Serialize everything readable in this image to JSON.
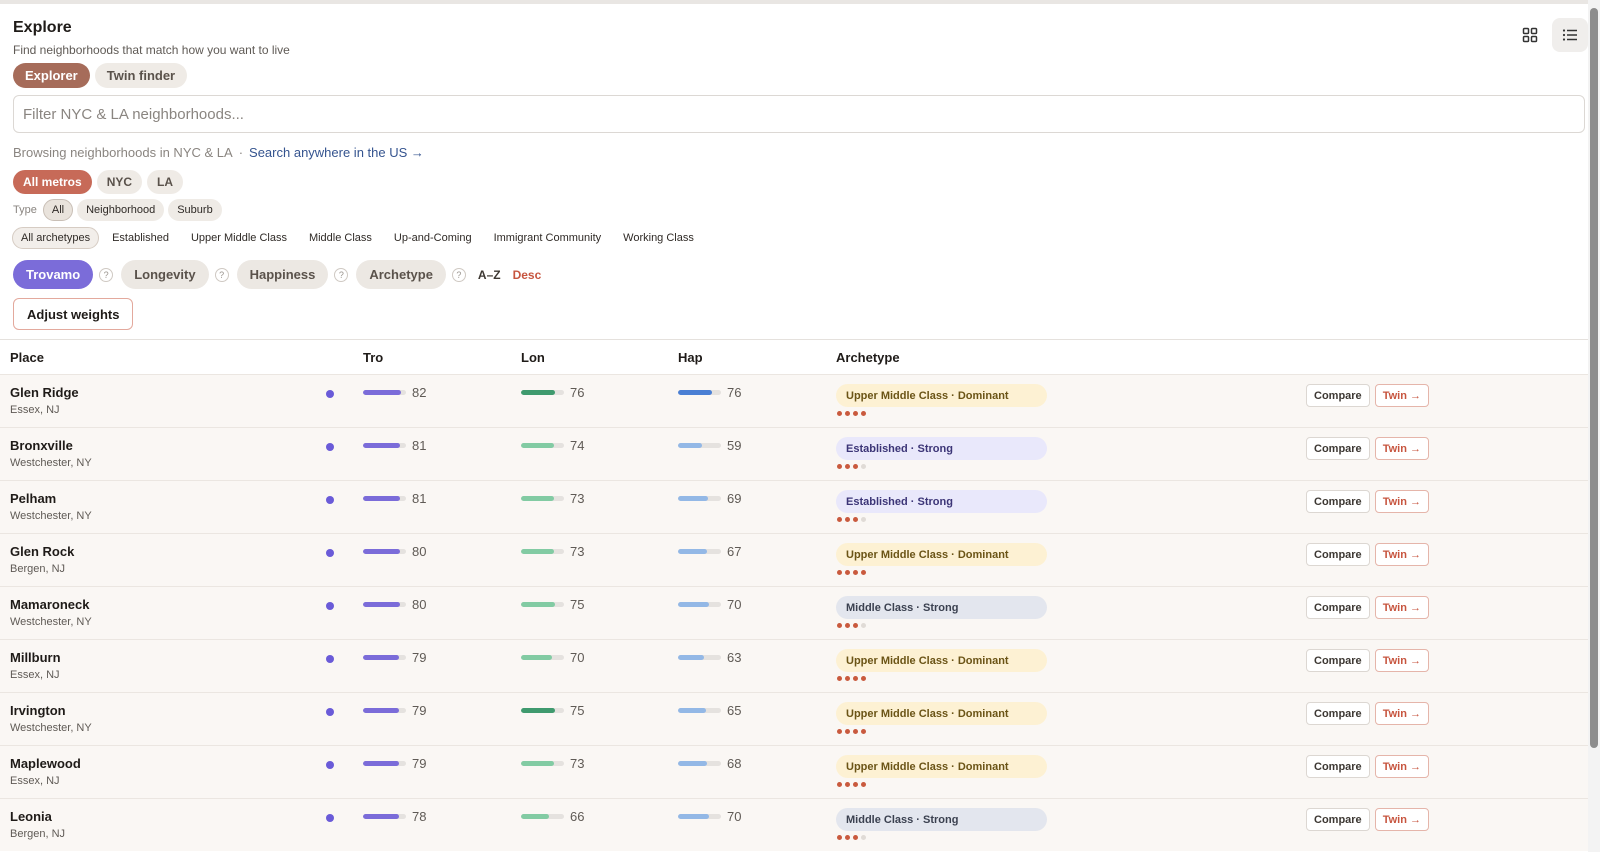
{
  "header": {
    "title": "Explore",
    "subtitle": "Find neighborhoods that match how you want to live"
  },
  "view_toggle": [
    {
      "icon": "grid-view-icon",
      "active": false
    },
    {
      "icon": "list-view-icon",
      "active": true
    }
  ],
  "mode_tabs": [
    "Explorer",
    "Twin finder"
  ],
  "search": {
    "placeholder": "Filter NYC & LA neighborhoods...",
    "value": ""
  },
  "browse": {
    "text": "Browsing neighborhoods in NYC & LA",
    "sep": "·",
    "link": "Search anywhere in the US →"
  },
  "metros": [
    "All metros",
    "NYC",
    "LA"
  ],
  "type_filter": {
    "label": "Type",
    "options": [
      "All",
      "Neighborhood",
      "Suburb"
    ]
  },
  "archetypes": [
    "All archetypes",
    "Established",
    "Upper Middle Class",
    "Middle Class",
    "Up-and-Coming",
    "Immigrant Community",
    "Working Class"
  ],
  "sort": {
    "options": [
      "Trovamo",
      "Longevity",
      "Happiness",
      "Archetype"
    ],
    "help": "?",
    "az": "A–Z",
    "direction": "Desc"
  },
  "adjust_label": "Adjust weights",
  "columns": {
    "place": "Place",
    "tro": "Tro",
    "lon": "Lon",
    "hap": "Hap",
    "archetype": "Archetype"
  },
  "actions": {
    "compare": "Compare",
    "twin": "Twin →"
  },
  "colors": {
    "tro": "#7b6cd9",
    "lon_dark": "#3f9a6e",
    "lon_light": "#82cba3",
    "hap_dark": "#4a7fd4",
    "hap_light": "#93b8e6",
    "umc_bg": "#fdf1d3",
    "umc_fg": "#6b5416",
    "est_bg": "#e9e8fb",
    "est_fg": "#3c3577",
    "mc_bg": "#e3e6ee",
    "mc_fg": "#3b4150"
  },
  "rows": [
    {
      "name": "Glen Ridge",
      "loc": "Essex, NJ",
      "tro": 82,
      "lon": 76,
      "hap": 76,
      "lon_dark": true,
      "hap_dark": true,
      "archetype": "Upper Middle Class · Dominant",
      "arch_key": "umc",
      "strength": 4
    },
    {
      "name": "Bronxville",
      "loc": "Westchester, NY",
      "tro": 81,
      "lon": 74,
      "hap": 59,
      "lon_dark": false,
      "hap_dark": false,
      "archetype": "Established · Strong",
      "arch_key": "est",
      "strength": 3
    },
    {
      "name": "Pelham",
      "loc": "Westchester, NY",
      "tro": 81,
      "lon": 73,
      "hap": 69,
      "lon_dark": false,
      "hap_dark": false,
      "archetype": "Established · Strong",
      "arch_key": "est",
      "strength": 3
    },
    {
      "name": "Glen Rock",
      "loc": "Bergen, NJ",
      "tro": 80,
      "lon": 73,
      "hap": 67,
      "lon_dark": false,
      "hap_dark": false,
      "archetype": "Upper Middle Class · Dominant",
      "arch_key": "umc",
      "strength": 4
    },
    {
      "name": "Mamaroneck",
      "loc": "Westchester, NY",
      "tro": 80,
      "lon": 75,
      "hap": 70,
      "lon_dark": false,
      "hap_dark": false,
      "archetype": "Middle Class · Strong",
      "arch_key": "mc",
      "strength": 3
    },
    {
      "name": "Millburn",
      "loc": "Essex, NJ",
      "tro": 79,
      "lon": 70,
      "hap": 63,
      "lon_dark": false,
      "hap_dark": false,
      "archetype": "Upper Middle Class · Dominant",
      "arch_key": "umc",
      "strength": 4
    },
    {
      "name": "Irvington",
      "loc": "Westchester, NY",
      "tro": 79,
      "lon": 75,
      "hap": 65,
      "lon_dark": true,
      "hap_dark": false,
      "archetype": "Upper Middle Class · Dominant",
      "arch_key": "umc",
      "strength": 4
    },
    {
      "name": "Maplewood",
      "loc": "Essex, NJ",
      "tro": 79,
      "lon": 73,
      "hap": 68,
      "lon_dark": false,
      "hap_dark": false,
      "archetype": "Upper Middle Class · Dominant",
      "arch_key": "umc",
      "strength": 4
    },
    {
      "name": "Leonia",
      "loc": "Bergen, NJ",
      "tro": 78,
      "lon": 66,
      "hap": 70,
      "lon_dark": false,
      "hap_dark": false,
      "archetype": "Middle Class · Strong",
      "arch_key": "mc",
      "strength": 3
    }
  ]
}
